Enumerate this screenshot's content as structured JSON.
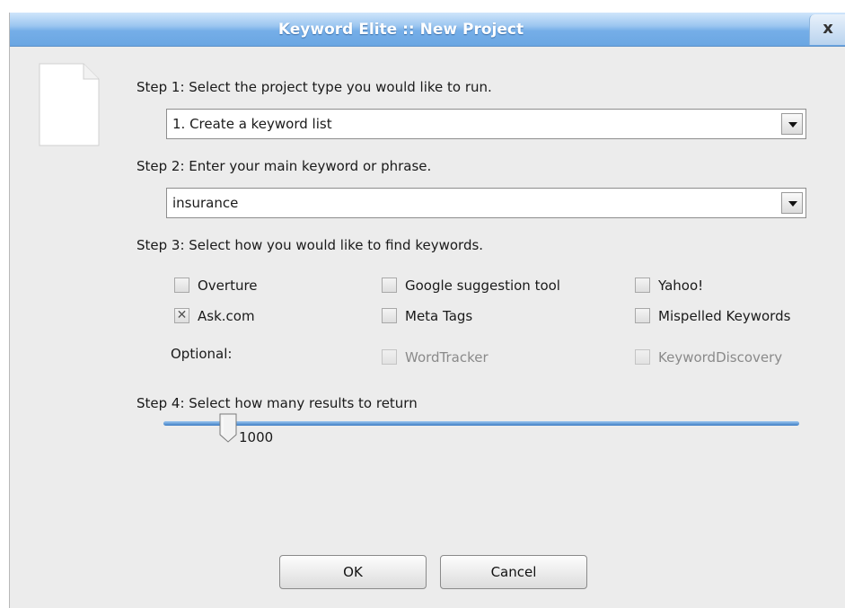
{
  "window": {
    "title": "Keyword Elite :: New Project",
    "close_label": "x"
  },
  "step1": {
    "label": "Step 1: Select the project type you would like to run.",
    "selected": "1. Create a keyword list"
  },
  "step2": {
    "label": "Step 2: Enter your main keyword or phrase.",
    "value": "insurance"
  },
  "step3": {
    "label": "Step 3: Select how you would like to find keywords.",
    "options": [
      {
        "label": "Overture",
        "checked": false,
        "enabled": true
      },
      {
        "label": "Google suggestion tool",
        "checked": false,
        "enabled": true
      },
      {
        "label": "Yahoo!",
        "checked": false,
        "enabled": true
      },
      {
        "label": "Ask.com",
        "checked": true,
        "enabled": true
      },
      {
        "label": "Meta Tags",
        "checked": false,
        "enabled": true
      },
      {
        "label": "Mispelled Keywords",
        "checked": false,
        "enabled": true
      }
    ],
    "optional_label": "Optional:",
    "optional": [
      {
        "label": "WordTracker",
        "checked": false,
        "enabled": false
      },
      {
        "label": "KeywordDiscovery",
        "checked": false,
        "enabled": false
      }
    ]
  },
  "step4": {
    "label": "Step 4: Select how many results to return",
    "value": "1000",
    "position_fraction": 0.1
  },
  "buttons": {
    "ok": "OK",
    "cancel": "Cancel"
  },
  "colors": {
    "titlebar": "#75aee8",
    "dialog_bg": "#ececec",
    "slider": "#3c7dc4"
  }
}
